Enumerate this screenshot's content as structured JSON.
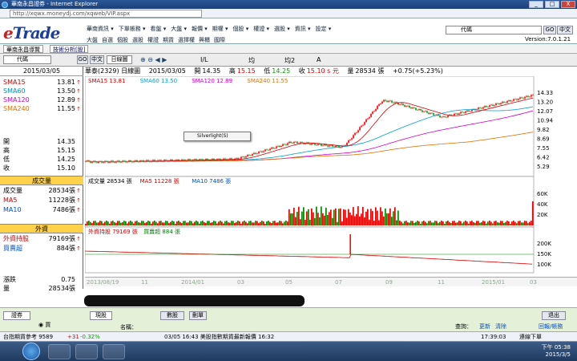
{
  "window": {
    "title": "華南永昌證券 - Internet Explorer",
    "address": "http://xqwx.moneydj.com/xqweb/VIP.aspx",
    "buttons": [
      "_",
      "□",
      "X"
    ]
  },
  "header": {
    "logo_letter": "e",
    "logo_text": "Trade",
    "menu": [
      "華南資訊 ▾",
      "下單帳務 ▾",
      "看盤 ▾",
      "大盤 ▾",
      "報價 ▾",
      "期權 ▾",
      "個股 ▾",
      "權證 ▾",
      "選股 ▾",
      "資訊 ▾",
      "設定 ▾"
    ],
    "submenu": [
      "大盤",
      "自選",
      "個股",
      "選股",
      "權證",
      "期貨",
      "選擇權",
      "興櫃",
      "國際"
    ],
    "code_label": "代碼",
    "go_label": "GO",
    "lang_label": "中文",
    "version": "Version:7.0.1.21"
  },
  "tabs": [
    "華南永昌導覽",
    "技術分析[股]"
  ],
  "toolbar": {
    "code_label": "代碼",
    "go_label": "GO",
    "lang_label": "中文",
    "period": "日線圖",
    "items": [
      "I/L",
      "均",
      "均2",
      "A"
    ]
  },
  "left_panel": {
    "date": "2015/03/05",
    "ma": [
      {
        "label": "SMA15",
        "value": "13.81",
        "color": "#d00000"
      },
      {
        "label": "SMA60",
        "value": "13.50",
        "color": "#0090c0"
      },
      {
        "label": "SMA120",
        "value": "12.89",
        "color": "#d000d0"
      },
      {
        "label": "SMA240",
        "value": "11.55",
        "color": "#e07000"
      }
    ],
    "ohlc": [
      {
        "label": "開",
        "value": "14.35"
      },
      {
        "label": "高",
        "value": "15.15"
      },
      {
        "label": "低",
        "value": "14.25"
      },
      {
        "label": "收",
        "value": "15.10"
      }
    ],
    "vol_head": "成交量",
    "vol": [
      {
        "label": "成交量",
        "value": "28534張",
        "color": "#000"
      },
      {
        "label": "MA5",
        "value": "11228張",
        "color": "#d00000"
      },
      {
        "label": "MA10",
        "value": "7486張",
        "color": "#0050d0"
      }
    ],
    "foreign_head": "外資",
    "foreign": [
      {
        "label": "外資持股",
        "value": "79169張",
        "color": "#d00000"
      },
      {
        "label": "買賣超",
        "value": "884張",
        "color": "#0050d0"
      }
    ],
    "bottom": [
      {
        "label": "漲跌",
        "value": "0.75"
      },
      {
        "label": "量",
        "value": "28534張"
      }
    ]
  },
  "infobar": {
    "name": "華泰(2329) 日線圖",
    "date": "2015/03/05",
    "open_label": "開",
    "open": "14.35",
    "high_label": "高",
    "high": "15.15",
    "low_label": "低",
    "low": "14.25",
    "close_label": "收",
    "close": "15.10 s 元",
    "vol_label": "量",
    "vol": "28534 張",
    "change": "+0.75(+5.23%)"
  },
  "price_panel": {
    "legend": [
      {
        "label": "SMA15 13.81",
        "color": "#d00000"
      },
      {
        "label": "SMA60 13.50",
        "color": "#00a0d0"
      },
      {
        "label": "SMA120 12.89",
        "color": "#d000d0"
      },
      {
        "label": "SMA240 11.55",
        "color": "#e07000"
      }
    ],
    "y_ticks": [
      "14.33",
      "13.20",
      "12.07",
      "10.94",
      "9.82",
      "8.69",
      "7.55",
      "6.42",
      "5.29"
    ]
  },
  "volume_panel": {
    "legend": [
      {
        "label": "成交量 28534 張",
        "color": "#000"
      },
      {
        "label": "MA5 11228 張",
        "color": "#d00000"
      },
      {
        "label": "MA10 7486 張",
        "color": "#0050d0"
      }
    ],
    "y_ticks": [
      "60K",
      "40K",
      "20K"
    ]
  },
  "foreign_panel": {
    "legend": [
      {
        "label": "外資持股 79169 張",
        "color": "#d00000"
      },
      {
        "label": "買賣超 884 張",
        "color": "#008000"
      }
    ],
    "y_ticks": [
      "200K",
      "150K",
      "100K"
    ]
  },
  "x_axis": [
    "2013/08/19",
    "11",
    "2014/01",
    "03",
    "05",
    "07",
    "09",
    "11",
    "2015/01",
    "03"
  ],
  "context_menu": {
    "item": "Silverlight(S)"
  },
  "order_bar": {
    "fields": [
      "證券",
      "現股",
      "名稱：",
      "數股",
      "刪單"
    ],
    "buy_label": "買",
    "links": [
      "更新",
      "清除"
    ],
    "query_label": "查詢：",
    "exit": "退出",
    "nav": "回報/帳務"
  },
  "status_bar": {
    "futures": "台指期貨參考 9589",
    "change": "+31",
    "pct": "-0.32%",
    "news": "03/05 16:43  美股指數期貨最新報價 16:32",
    "time": "17:39:03",
    "connect": "連線下單"
  },
  "taskbar": {
    "time": "下午 05:38",
    "date": "2015/3/5"
  }
}
